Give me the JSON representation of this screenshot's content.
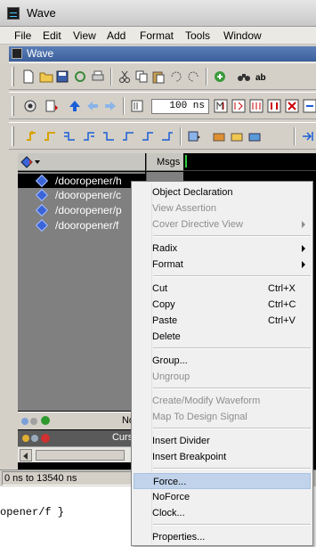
{
  "window": {
    "title": "Wave"
  },
  "menubar": [
    "File",
    "Edit",
    "View",
    "Add",
    "Format",
    "Tools",
    "Window"
  ],
  "subwindow": {
    "title": "Wave"
  },
  "toolbar": {
    "time_value": "100",
    "time_unit": "ns"
  },
  "wave": {
    "msgs_header": "Msgs",
    "signals": [
      "/dooropener/h",
      "/dooropener/c",
      "/dooropener/p",
      "/dooropener/f"
    ],
    "now_label": "Now",
    "cursor_label": "Cursor"
  },
  "status": {
    "range": "0 ns to 13540 ns"
  },
  "console": {
    "line": "opener/f }"
  },
  "context_menu": {
    "groups": [
      [
        {
          "label": "Object Declaration",
          "enabled": true
        },
        {
          "label": "View Assertion",
          "enabled": false
        },
        {
          "label": "Cover Directive View",
          "enabled": false,
          "submenu": true
        }
      ],
      [
        {
          "label": "Radix",
          "enabled": true,
          "submenu": true
        },
        {
          "label": "Format",
          "enabled": true,
          "submenu": true
        }
      ],
      [
        {
          "label": "Cut",
          "enabled": true,
          "shortcut": "Ctrl+X"
        },
        {
          "label": "Copy",
          "enabled": true,
          "shortcut": "Ctrl+C"
        },
        {
          "label": "Paste",
          "enabled": true,
          "shortcut": "Ctrl+V"
        },
        {
          "label": "Delete",
          "enabled": true
        }
      ],
      [
        {
          "label": "Group...",
          "enabled": true
        },
        {
          "label": "Ungroup",
          "enabled": false
        }
      ],
      [
        {
          "label": "Create/Modify Waveform",
          "enabled": false
        },
        {
          "label": "Map To Design Signal",
          "enabled": false
        }
      ],
      [
        {
          "label": "Insert Divider",
          "enabled": true
        },
        {
          "label": "Insert Breakpoint",
          "enabled": true
        }
      ],
      [
        {
          "label": "Force...",
          "enabled": true,
          "highlighted": true
        },
        {
          "label": "NoForce",
          "enabled": true
        },
        {
          "label": "Clock...",
          "enabled": true
        }
      ],
      [
        {
          "label": "Properties...",
          "enabled": true
        }
      ]
    ]
  },
  "colors": {
    "selection": "#c0d3ea",
    "signal_icon": "#3a64d8",
    "cursor_marker": "#2ecc40"
  }
}
